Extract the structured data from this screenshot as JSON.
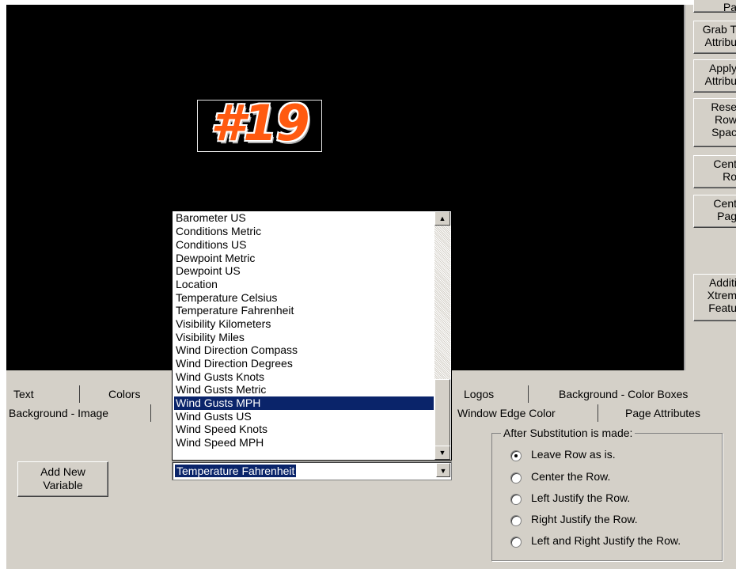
{
  "side_buttons": [
    "Pa",
    "Grab T\nAttribu",
    "Apply\nAttribu",
    "Rese\nRow\nSpac",
    "Cent\nRo",
    "Cent\nPag",
    "Additi\nXtrem\nFeatu"
  ],
  "logo_text": "#19",
  "tabs_row1": [
    "Text",
    "Colors",
    "Logos",
    "Background - Color Boxes"
  ],
  "tabs_row2": [
    "Background - Image",
    "Window Edge Color",
    "Page Attributes"
  ],
  "add_variable_label": "Add New\nVariable",
  "dropdown": {
    "items": [
      "Barometer US",
      "Conditions Metric",
      "Conditions US",
      "Dewpoint Metric",
      "Dewpoint US",
      "Location",
      "Temperature Celsius",
      "Temperature Fahrenheit",
      "Visibility Kilometers",
      "Visibility Miles",
      "Wind Direction Compass",
      "Wind Direction Degrees",
      "Wind Gusts Knots",
      "Wind Gusts Metric",
      "Wind Gusts MPH",
      "Wind Gusts US",
      "Wind Speed Knots",
      "Wind Speed MPH"
    ],
    "highlighted": "Wind Gusts MPH",
    "selected_value": "Temperature Fahrenheit"
  },
  "substitution": {
    "title": "After Substitution is made:",
    "options": [
      "Leave Row as is.",
      "Center the Row.",
      "Left Justify the Row.",
      "Right Justify the Row.",
      "Left and Right Justify the Row."
    ],
    "selected_index": 0
  },
  "colors": {
    "panel": "#d4d0c8",
    "highlight": "#0a246a",
    "logo": "#ff5a10"
  }
}
